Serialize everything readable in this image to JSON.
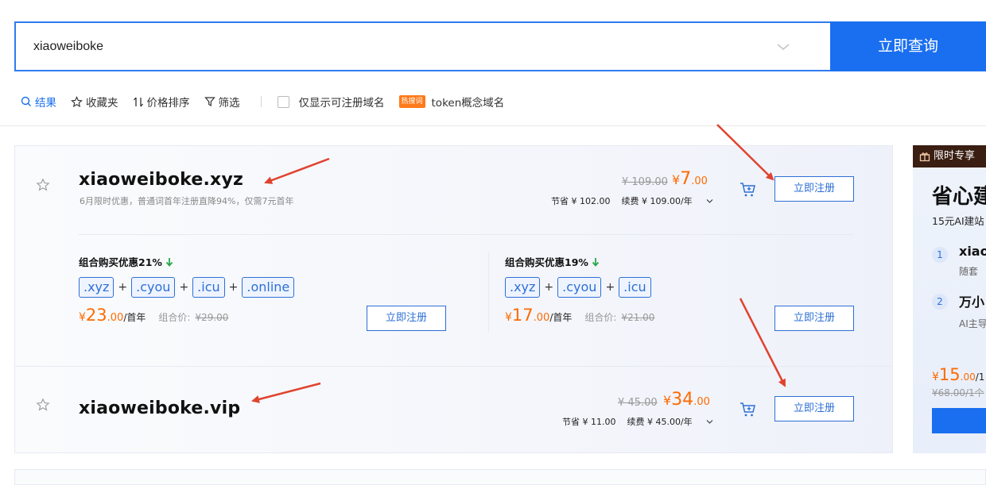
{
  "search": {
    "value": "xiaoweiboke",
    "button_label": "立即查询"
  },
  "toolbar": {
    "results_label": "结果",
    "favorites_label": "收藏夹",
    "price_sort_label": "价格排序",
    "filter_label": "筛选",
    "only_available_label": "仅显示可注册域名",
    "hot_badge": "热搜词",
    "hot_link": "token概念域名"
  },
  "results": [
    {
      "domain": "xiaoweiboke.xyz",
      "note": "6月限时优惠，普通词首年注册直降94%，仅需7元首年",
      "orig_price": "¥ 109.00",
      "price_yen": "¥",
      "price_int": "7",
      "price_dec": ".00",
      "save_text": "节省 ¥ 102.00",
      "renew_text": "续费 ¥ 109.00/年",
      "register_label": "立即注册"
    },
    {
      "domain": "xiaoweiboke.vip",
      "orig_price": "¥ 45.00",
      "price_yen": "¥",
      "price_int": "34",
      "price_dec": ".00",
      "save_text": "节省 ¥ 11.00",
      "renew_text": "续费 ¥ 45.00/年",
      "register_label": "立即注册"
    }
  ],
  "bundles": [
    {
      "title": "组合购买优惠21%",
      "tags": [
        ".xyz",
        ".cyou",
        ".icu",
        ".online"
      ],
      "price_yen": "¥",
      "price_int": "23",
      "price_dec": ".00",
      "price_unit": "/首年",
      "combo_label": "组合价:",
      "combo_value": "¥29.00",
      "register_label": "立即注册"
    },
    {
      "title": "组合购买优惠19%",
      "tags": [
        ".xyz",
        ".cyou",
        ".icu"
      ],
      "price_yen": "¥",
      "price_int": "17",
      "price_dec": ".00",
      "price_unit": "/首年",
      "combo_label": "组合价:",
      "combo_value": "¥21.00",
      "register_label": "立即注册"
    }
  ],
  "promo": {
    "badge": "限时专享",
    "title": "省心建",
    "subtitle": "15元AI建站",
    "steps": [
      {
        "num": "1",
        "title": "xiao",
        "desc": "随套"
      },
      {
        "num": "2",
        "title": "万小",
        "desc": "AI主导"
      }
    ],
    "price_yen": "¥",
    "price_int": "15",
    "price_dec": ".00",
    "price_unit": "/1",
    "orig_price": "¥68.00/1个"
  },
  "colors": {
    "accent": "#1a6ff0",
    "price": "#ff6a00",
    "annotation_arrow": "#e0432e"
  }
}
